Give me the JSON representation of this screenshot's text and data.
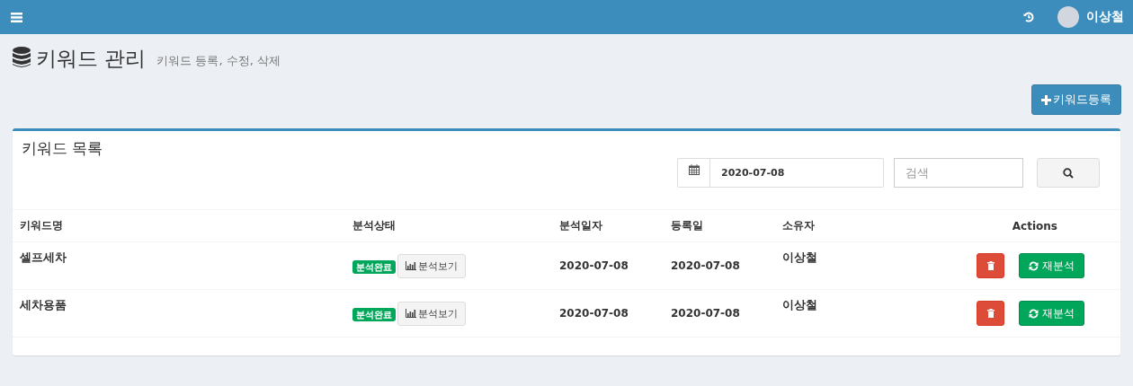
{
  "top_bar": {
    "user_name": "이상철"
  },
  "page": {
    "title": "키워드 관리",
    "subtitle": "키워드 등록, 수정, 삭제",
    "add_button": "키워드등록"
  },
  "box": {
    "title": "키워드 목록",
    "date_value": "2020-07-08",
    "search_placeholder": "검색"
  },
  "table": {
    "columns": [
      "키워드명",
      "분석상태",
      "분석일자",
      "등록일",
      "소유자",
      "Actions"
    ],
    "rows": [
      {
        "keyword": "셀프세차",
        "status": "분석완료",
        "view_button": "분석보기",
        "analyzed": "2020-07-08",
        "registered": "2020-07-08",
        "owner": "이상철",
        "reanalyze_button": "재분석"
      },
      {
        "keyword": "세차용품",
        "status": "분석완료",
        "view_button": "분석보기",
        "analyzed": "2020-07-08",
        "registered": "2020-07-08",
        "owner": "이상철",
        "reanalyze_button": "재분석"
      }
    ]
  }
}
